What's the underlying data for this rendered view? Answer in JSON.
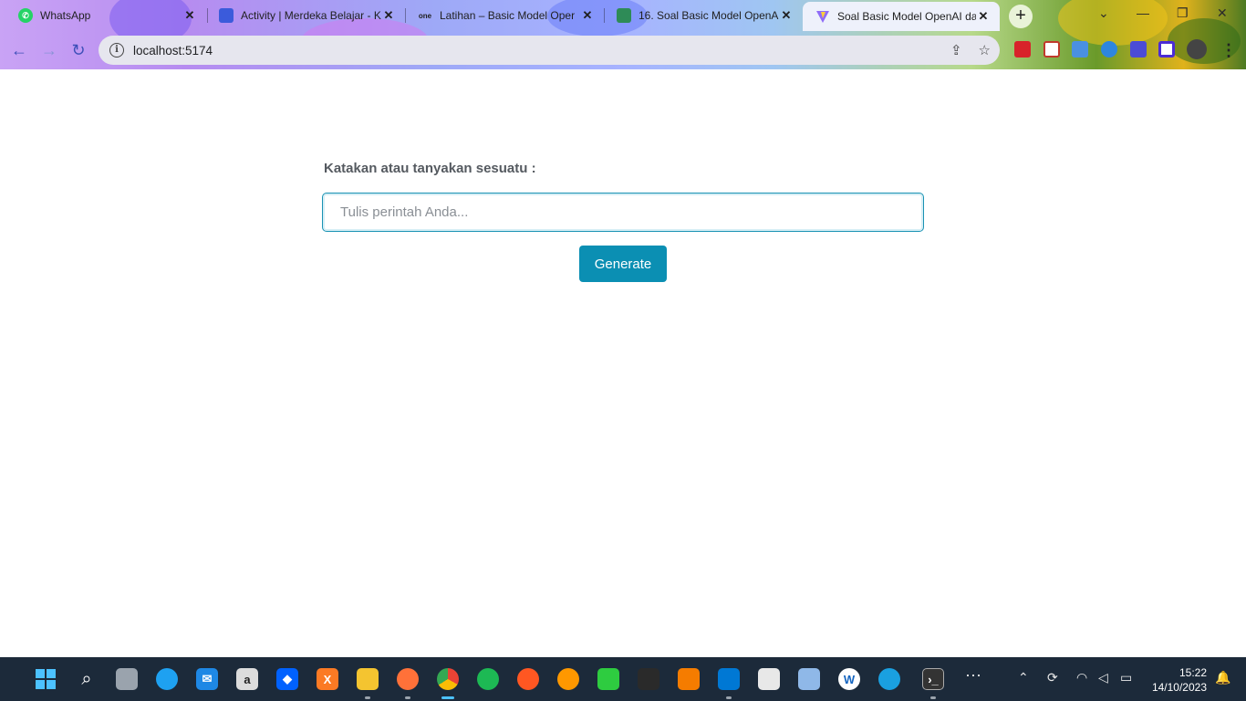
{
  "browser": {
    "tabs": [
      {
        "title": "WhatsApp",
        "favicon": "whatsapp-icon"
      },
      {
        "title": "Activity | Merdeka Belajar - K",
        "favicon": "kampus-merdeka-icon"
      },
      {
        "title": "Latihan – Basic Model Oper",
        "favicon": "onenote-icon",
        "favicon_text": "one"
      },
      {
        "title": "16. Soal Basic Model OpenA",
        "favicon": "book-icon"
      },
      {
        "title": "Soal Basic Model OpenAI da",
        "favicon": "vite-icon",
        "active": true
      }
    ],
    "url": "localhost:5174"
  },
  "form": {
    "label": "Katakan atau tanyakan sesuatu :",
    "input_value": "",
    "input_placeholder": "Tulis perintah Anda...",
    "button_label": "Generate"
  },
  "colors": {
    "accent": "#0b8fb3",
    "input_border": "#1b93b4",
    "label": "#555a60",
    "taskbar": "#1c2a3a"
  },
  "taskbar": {
    "time": "15:22",
    "date": "14/10/2023"
  }
}
